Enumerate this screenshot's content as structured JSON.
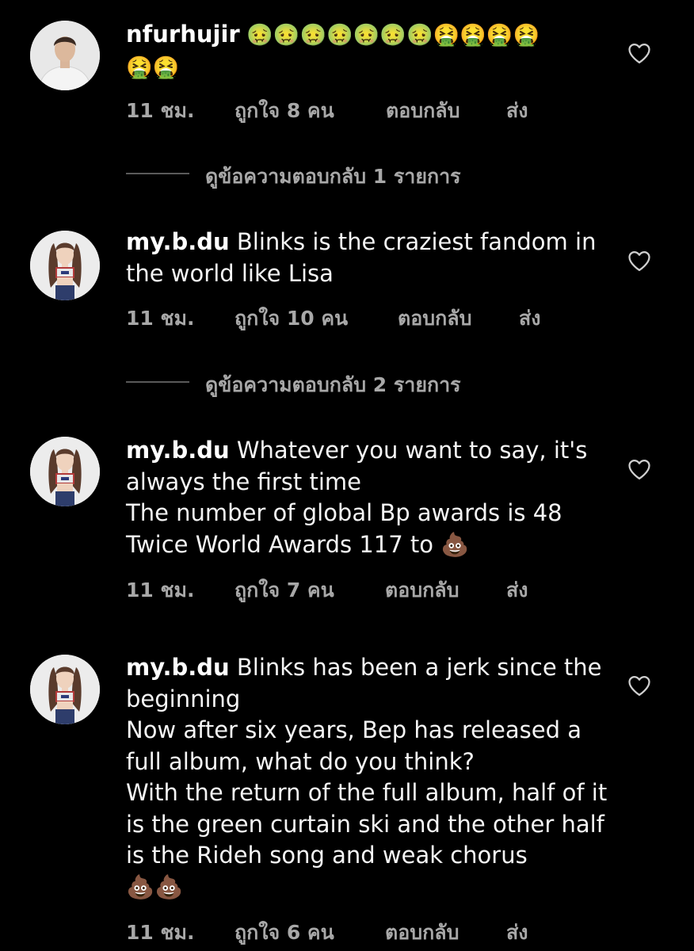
{
  "comments": [
    {
      "username": "nfurhujir",
      "text": " 🤢🤢🤢🤢🤢🤢🤢🤮🤮🤮🤮\n🤮🤮",
      "time": "11 ชม.",
      "likes": "ถูกใจ 8 คน",
      "reply": "ตอบกลับ",
      "send": "ส่ง",
      "view_replies": "ดูข้อความตอบกลับ 1 รายการ"
    },
    {
      "username": "my.b.du",
      "text": " Blinks is the craziest fandom in the world like Lisa",
      "time": "11 ชม.",
      "likes": "ถูกใจ 10 คน",
      "reply": "ตอบกลับ",
      "send": "ส่ง",
      "view_replies": "ดูข้อความตอบกลับ 2 รายการ"
    },
    {
      "username": "my.b.du",
      "text": " Whatever you want to say, it's always the first time\nThe number of global Bp awards is 48\nTwice World Awards 117 to 💩",
      "time": "11 ชม.",
      "likes": "ถูกใจ 7 คน",
      "reply": "ตอบกลับ",
      "send": "ส่ง"
    },
    {
      "username": "my.b.du",
      "text": " Blinks has been a jerk since the beginning\nNow after six years, Bep has released a full album, what do you think?\nWith the return of the full album, half of it is the green curtain ski and the other half is the Rideh song and weak chorus\n💩💩",
      "time": "11 ชม.",
      "likes": "ถูกใจ 6 คน",
      "reply": "ตอบกลับ",
      "send": "ส่ง"
    }
  ],
  "icons": {
    "like": "heart-outline-icon"
  },
  "colors": {
    "background": "#000000",
    "text": "#f5f5f5",
    "meta": "#a8a8a8"
  }
}
